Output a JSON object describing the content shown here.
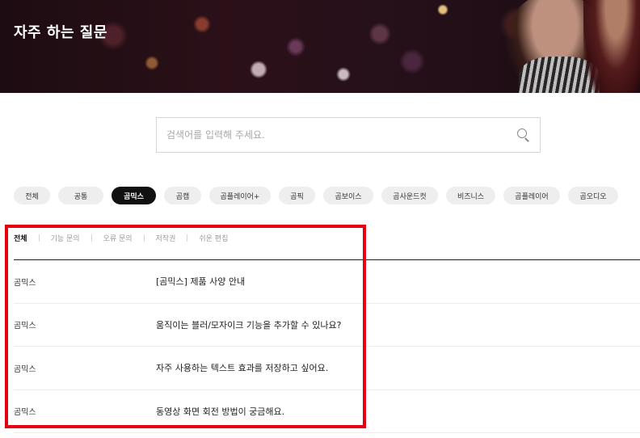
{
  "hero": {
    "title": "자주 하는 질문"
  },
  "search": {
    "placeholder": "검색어를 입력해 주세요.",
    "value": ""
  },
  "categories": [
    {
      "label": "전체",
      "active": false
    },
    {
      "label": "공통",
      "active": false
    },
    {
      "label": "곰믹스",
      "active": true
    },
    {
      "label": "곰캠",
      "active": false
    },
    {
      "label": "곰플레이어+",
      "active": false
    },
    {
      "label": "곰픽",
      "active": false
    },
    {
      "label": "곰보이스",
      "active": false
    },
    {
      "label": "곰사운드컷",
      "active": false
    },
    {
      "label": "비즈니스",
      "active": false
    },
    {
      "label": "곰플레이어",
      "active": false
    },
    {
      "label": "곰오디오",
      "active": false
    }
  ],
  "subtabs": [
    {
      "label": "전체",
      "active": true
    },
    {
      "label": "기능 문의",
      "active": false
    },
    {
      "label": "오류 문의",
      "active": false
    },
    {
      "label": "저작권",
      "active": false
    },
    {
      "label": "쉬운 편집",
      "active": false
    }
  ],
  "faqs": [
    {
      "category": "곰믹스",
      "question": "[곰믹스] 제품 사양 안내"
    },
    {
      "category": "곰믹스",
      "question": "움직이는 블러/모자이크 기능을 추가할 수 있나요?"
    },
    {
      "category": "곰믹스",
      "question": "자주 사용하는 텍스트 효과를 저장하고 싶어요."
    },
    {
      "category": "곰믹스",
      "question": "동영상 화면 회전 방법이 궁금해요."
    }
  ],
  "colors": {
    "highlight": "#e60012",
    "active_chip": "#111111",
    "chip": "#eeeeee"
  }
}
